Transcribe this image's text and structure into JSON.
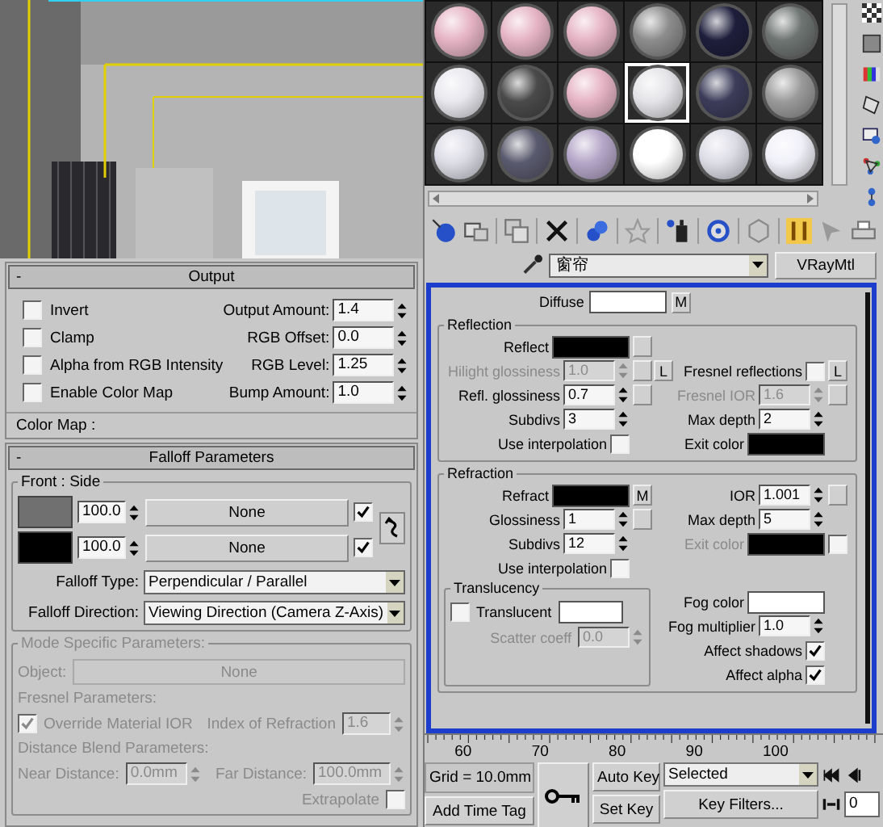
{
  "output": {
    "collapse": "-",
    "title": "Output",
    "checkboxes": [
      {
        "label": "Invert",
        "checked": false
      },
      {
        "label": "Clamp",
        "checked": false
      },
      {
        "label": "Alpha from RGB Intensity",
        "checked": false
      },
      {
        "label": "Enable Color Map",
        "checked": false
      }
    ],
    "spinners": [
      {
        "label": "Output Amount:",
        "value": "1.4"
      },
      {
        "label": "RGB Offset:",
        "value": "0.0"
      },
      {
        "label": "RGB Level:",
        "value": "1.25"
      },
      {
        "label": "Bump Amount:",
        "value": "1.0"
      }
    ],
    "color_map": "Color Map :"
  },
  "falloff": {
    "collapse": "-",
    "title": "Falloff Parameters",
    "front_side": {
      "title": "Front : Side",
      "rows": [
        {
          "color": "#707070",
          "amount": "100.0",
          "map": "None",
          "checked": true
        },
        {
          "color": "#000000",
          "amount": "100.0",
          "map": "None",
          "checked": true
        }
      ]
    },
    "falloff_type": {
      "label": "Falloff Type:",
      "value": "Perpendicular / Parallel"
    },
    "falloff_direction": {
      "label": "Falloff Direction:",
      "value": "Viewing Direction (Camera Z-Axis)"
    },
    "mode": {
      "title": "Mode Specific Parameters:",
      "disabled": true,
      "object_label": "Object:",
      "object_value": "None",
      "fresnel_title": "Fresnel Parameters:",
      "override": {
        "label": "Override Material IOR",
        "checked": true
      },
      "ior": {
        "label": "Index of Refraction",
        "value": "1.6"
      },
      "distance_title": "Distance Blend Parameters:",
      "near": {
        "label": "Near Distance:",
        "value": "0.0mm"
      },
      "far": {
        "label": "Far Distance:",
        "value": "100.0mm"
      },
      "extrapolate": {
        "label": "Extrapolate",
        "checked": false
      }
    }
  },
  "material": {
    "slots": [
      {
        "color": "#e6b4c4",
        "selected": false
      },
      {
        "color": "#e6b4c4",
        "selected": false
      },
      {
        "color": "#e6b4c4",
        "selected": false
      },
      {
        "color": "#8c8c8c",
        "selected": false
      },
      {
        "color": "#1e1e3c",
        "selected": false
      },
      {
        "color": "#6e7472",
        "selected": false
      },
      {
        "color": "#e8e8ee",
        "selected": false
      },
      {
        "color": "#4a4a4a",
        "selected": false
      },
      {
        "color": "#e6b4c4",
        "selected": false
      },
      {
        "color": "#e4e4e8",
        "selected": true
      },
      {
        "color": "#3c3c5a",
        "selected": false
      },
      {
        "color": "#9a9a9a",
        "selected": false
      },
      {
        "color": "#dcdce6",
        "selected": false
      },
      {
        "color": "#5a5a6e",
        "selected": false
      },
      {
        "color": "#b4a6c8",
        "selected": false
      },
      {
        "color": "#ffffff",
        "selected": false
      },
      {
        "color": "#dcdce6",
        "selected": false
      },
      {
        "color": "#f0f0f8",
        "selected": false
      }
    ],
    "name": "窗帘",
    "type": "VRayMtl",
    "diffuse": {
      "label": "Diffuse",
      "color": "#ffffff",
      "map": "M"
    },
    "reflection": {
      "title": "Reflection",
      "rows": [
        {
          "left": {
            "kind": "color",
            "label": "Reflect",
            "color": "#000000",
            "map": true
          }
        },
        {
          "left": {
            "kind": "spinner",
            "label": "Hilight glossiness",
            "value": "1.0",
            "disabled": true,
            "map": true,
            "lock": "L"
          },
          "right": {
            "kind": "checkbox",
            "label": "Fresnel reflections",
            "checked": false,
            "lock": "L"
          }
        },
        {
          "left": {
            "kind": "spinner",
            "label": "Refl. glossiness",
            "value": "0.7",
            "map": true
          },
          "right": {
            "kind": "spinner",
            "label": "Fresnel IOR",
            "value": "1.6",
            "disabled": true,
            "map": true
          }
        },
        {
          "left": {
            "kind": "spinner",
            "label": "Subdivs",
            "value": "3"
          },
          "right": {
            "kind": "spinner",
            "label": "Max depth",
            "value": "2"
          }
        },
        {
          "left": {
            "kind": "checkbox",
            "label": "Use interpolation",
            "checked": false
          },
          "right": {
            "kind": "color",
            "label": "Exit color",
            "color": "#000000"
          }
        }
      ]
    },
    "refraction": {
      "title": "Refraction",
      "rows": [
        {
          "left": {
            "kind": "color",
            "label": "Refract",
            "color": "#000000",
            "map": "M"
          },
          "right": {
            "kind": "spinner",
            "label": "IOR",
            "value": "1.001",
            "map": true
          }
        },
        {
          "left": {
            "kind": "spinner",
            "label": "Glossiness",
            "value": "1",
            "map": true
          },
          "right": {
            "kind": "spinner",
            "label": "Max depth",
            "value": "5"
          }
        },
        {
          "left": {
            "kind": "spinner",
            "label": "Subdivs",
            "value": "12"
          },
          "right": {
            "kind": "color",
            "label": "Exit color",
            "color": "#000000",
            "disabled": true,
            "checked": false
          }
        },
        {
          "left": {
            "kind": "checkbox",
            "label": "Use interpolation",
            "checked": false
          }
        }
      ],
      "translucency": {
        "title": "Translucency",
        "translucent": {
          "label": "Translucent",
          "checked": false,
          "color": "#ffffff"
        },
        "scatter": {
          "label": "Scatter coeff",
          "value": "0.0",
          "disabled": true
        }
      },
      "fog": [
        {
          "kind": "color",
          "label": "Fog color",
          "color": "#ffffff"
        },
        {
          "kind": "spinner",
          "label": "Fog multiplier",
          "value": "1.0"
        },
        {
          "kind": "checkbox",
          "label": "Affect shadows",
          "checked": true
        },
        {
          "kind": "checkbox",
          "label": "Affect alpha",
          "checked": true
        }
      ]
    }
  },
  "timeline": {
    "ticks": [
      "60",
      "70",
      "80",
      "90",
      "100"
    ],
    "grid": "Grid = 10.0mm",
    "add_time_tag": "Add Time Tag",
    "auto_key": "Auto Key",
    "set_key": "Set Key",
    "key_mode": "Selected",
    "key_filters": "Key Filters...",
    "frame": "0"
  }
}
